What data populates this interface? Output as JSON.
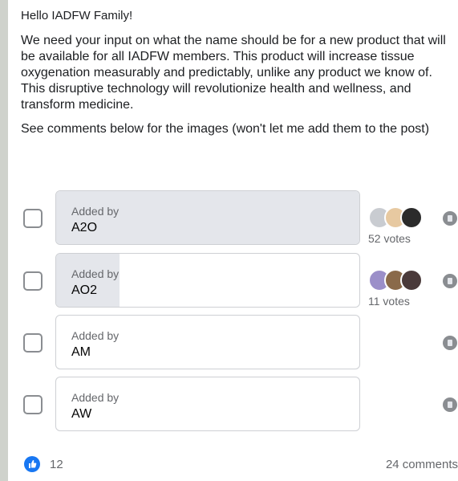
{
  "post": {
    "greeting": "Hello IADFW Family!",
    "body": "We need your input on what the name should be for a new product that will be available for all IADFW members. This product will increase tissue oxygenation measurably and predictably, unlike any product we know of. This disruptive technology will revolutionize health and wellness, and transform medicine.",
    "note": "See comments below for the images (won't let me add them to the post)"
  },
  "poll": {
    "options": [
      {
        "added_by": "Added by",
        "name": "A2O",
        "votes": "52 votes",
        "vote_count": 52,
        "fill_fraction": 1.0,
        "more_icon": "more-options-icon"
      },
      {
        "added_by": "Added by",
        "name": "AO2",
        "votes": "11 votes",
        "vote_count": 11,
        "fill_fraction": 0.21,
        "more_icon": "more-options-icon"
      },
      {
        "added_by": "Added by",
        "name": "AM",
        "votes": "",
        "vote_count": 0,
        "fill_fraction": 0,
        "more_icon": "more-options-icon"
      },
      {
        "added_by": "Added by",
        "name": "AW",
        "votes": "",
        "vote_count": 0,
        "fill_fraction": 0,
        "more_icon": "more-options-icon"
      }
    ]
  },
  "footer": {
    "like_icon": "like-thumb-icon",
    "like_count": "12",
    "comments": "24 comments"
  },
  "colors": {
    "accent": "#1877f2",
    "fill": "#e4e6eb",
    "border": "#ced0d4",
    "muted_text": "#65676b"
  }
}
